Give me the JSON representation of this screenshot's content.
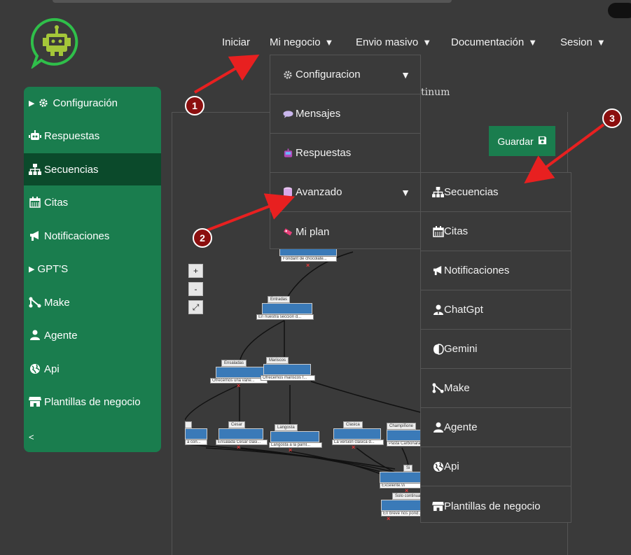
{
  "nav": {
    "iniciar": "Iniciar",
    "mi_negocio": "Mi negocio",
    "envio_masivo": "Envio masivo",
    "documentacion": "Documentación",
    "sesion": "Sesion",
    "caret": "▼"
  },
  "dropdown_main": {
    "items": [
      {
        "label": "Configuracion",
        "icon": "gear-icon",
        "has_submenu": true
      },
      {
        "label": "Mensajes",
        "icon": "speech-bubble-icon",
        "has_submenu": false
      },
      {
        "label": "Respuestas",
        "icon": "robot-icon",
        "has_submenu": false
      },
      {
        "label": "Avanzado",
        "icon": "database-icon",
        "has_submenu": true
      },
      {
        "label": "Mi plan",
        "icon": "ticket-icon",
        "has_submenu": false
      }
    ],
    "caret": "▼"
  },
  "dropdown_sub": {
    "items": [
      {
        "label": "Secuencias",
        "icon": "sitemap-icon"
      },
      {
        "label": "Citas",
        "icon": "calendar-icon"
      },
      {
        "label": "Notificaciones",
        "icon": "bullhorn-icon"
      },
      {
        "label": "ChatGpt",
        "icon": "user-tie-icon"
      },
      {
        "label": "Gemini",
        "icon": "brain-icon"
      },
      {
        "label": "Make",
        "icon": "branch-icon"
      },
      {
        "label": "Agente",
        "icon": "user-icon"
      },
      {
        "label": "Api",
        "icon": "globe-icon"
      },
      {
        "label": "Plantillas de negocio",
        "icon": "store-icon"
      }
    ]
  },
  "sidebar": {
    "items": [
      {
        "label": "Configuración",
        "icon": "gear-icon",
        "prefix": "▶"
      },
      {
        "label": "Respuestas",
        "icon": "robot-icon"
      },
      {
        "label": "Secuencias",
        "icon": "sitemap-icon",
        "active": true
      },
      {
        "label": "Citas",
        "icon": "calendar-icon"
      },
      {
        "label": "Notificaciones",
        "icon": "bullhorn-icon"
      },
      {
        "label": "GPT'S",
        "icon": "",
        "prefix": "▶"
      },
      {
        "label": "Make",
        "icon": "branch-icon"
      },
      {
        "label": "Agente",
        "icon": "user-icon"
      },
      {
        "label": "Api",
        "icon": "globe-icon"
      },
      {
        "label": "Plantillas de negocio",
        "icon": "store-icon"
      }
    ],
    "collapse": "<"
  },
  "content": {
    "platinum_fragment": "tinum",
    "save_label": "Guardar",
    "zoom_in": "+",
    "zoom_out": "-",
    "fullscreen": "⤢"
  },
  "flow": {
    "nodes": [
      {
        "title": "",
        "sub": "Fondant de chocolate..."
      },
      {
        "title": "Entradas",
        "sub": "En nuestra seccion d..."
      },
      {
        "title": "Ensaladas",
        "sub": "Ofrecemos una varie..."
      },
      {
        "title": "Mariscos",
        "sub": "Ofrecemos mariscos f..."
      },
      {
        "title": "",
        "sub": "a con..."
      },
      {
        "title": "Cesar",
        "sub": "Ensalada Cesar clasi..."
      },
      {
        "title": "Langosta",
        "sub": "Langosta a la parril..."
      },
      {
        "title": "Clasica",
        "sub": "La version clasica d..."
      },
      {
        "title": "Champiñone",
        "sub": "Pasta Carbonara"
      },
      {
        "title": "Si",
        "sub": "Excelente.\\n"
      },
      {
        "title": "Solo continua",
        "sub": "En breve nos pond..."
      }
    ]
  },
  "markers": [
    "1",
    "2",
    "3"
  ],
  "colors": {
    "background": "#3a3a3a",
    "sidebar": "#1a7d4e",
    "sidebar_active": "#0b4a2b",
    "node_bar": "#3a7ab8",
    "arrow": "#e82020",
    "marker": "#8b0f0f"
  }
}
